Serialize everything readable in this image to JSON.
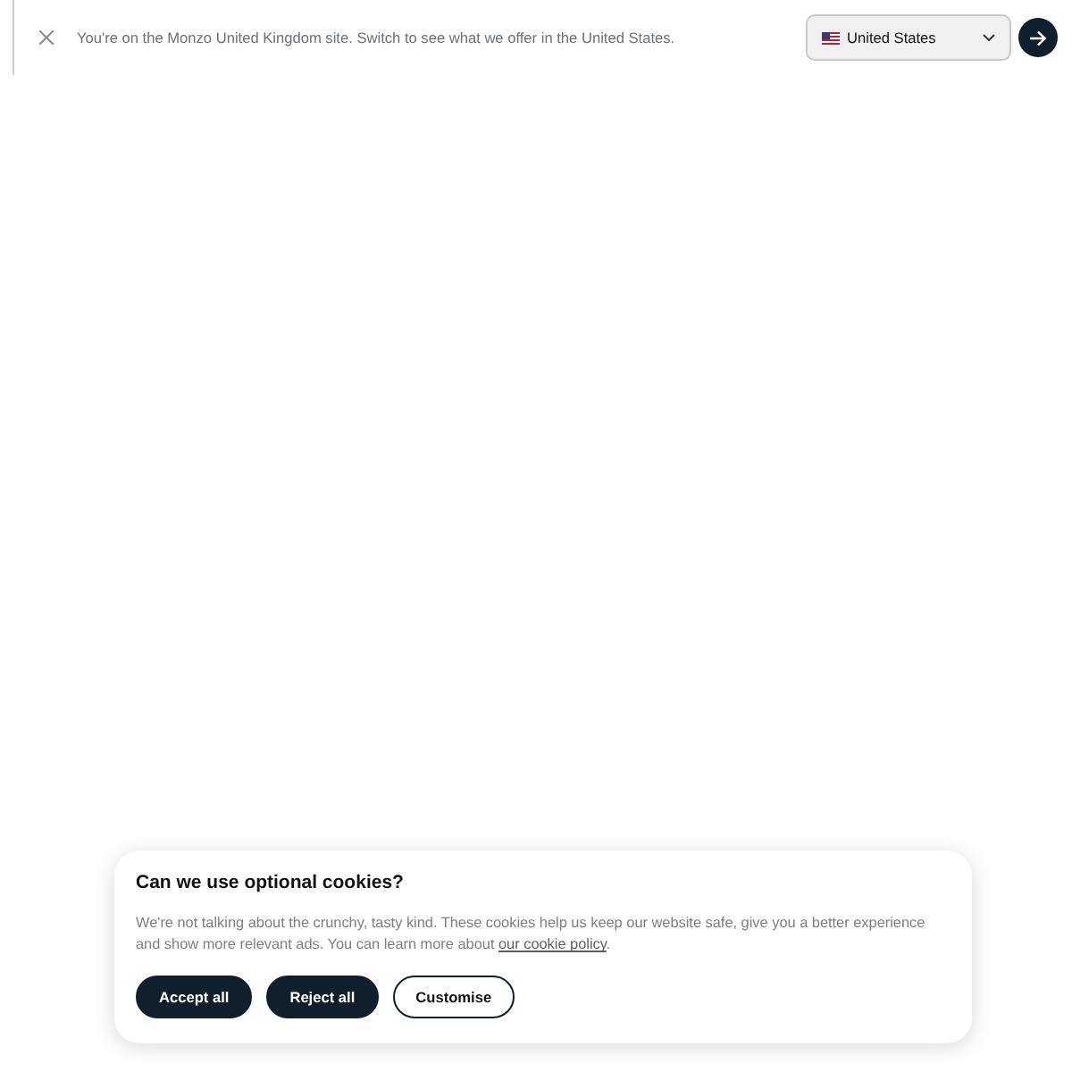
{
  "region_banner": {
    "message": "You're on the Monzo United Kingdom site. Switch to see what we offer in the United States.",
    "country_select": {
      "value": "United States"
    }
  },
  "cookie_dialog": {
    "title": "Can we use optional cookies?",
    "body": "We're not talking about the crunchy, tasty kind. These cookies help us keep our website safe, give you a better experience and show more relevant ads. You can learn more about ",
    "link": "our cookie policy",
    "body_end": ".",
    "buttons": [
      {
        "label": "Accept all",
        "kind": "filled"
      },
      {
        "label": "Reject all",
        "kind": "filled"
      },
      {
        "label": "Customise",
        "kind": "outline"
      }
    ]
  }
}
